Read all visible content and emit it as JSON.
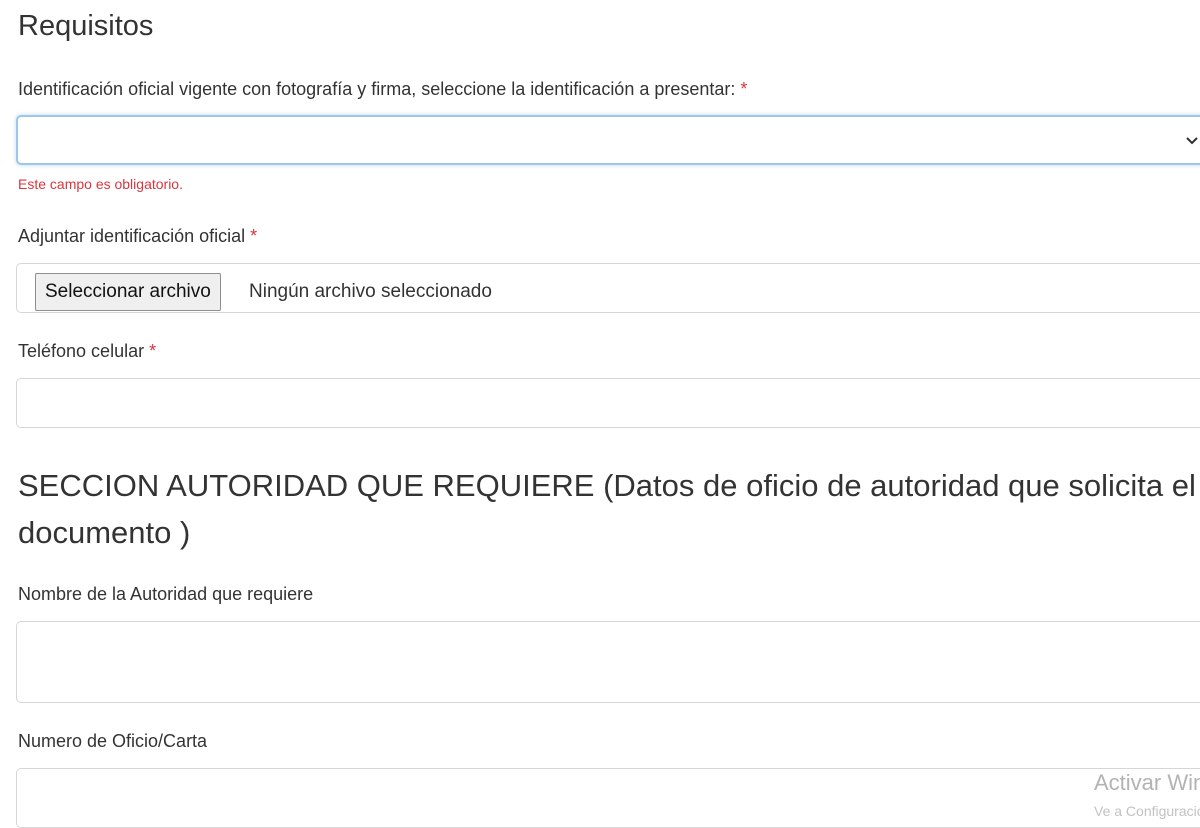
{
  "section_requisitos": {
    "title": "Requisitos"
  },
  "identificacion": {
    "label": "Identificación oficial vigente con fotografía y firma, seleccione la identificación a presentar:",
    "required_mark": "*",
    "selected_value": "",
    "error": "Este campo es obligatorio."
  },
  "adjuntar": {
    "label": "Adjuntar identificación oficial",
    "required_mark": "*",
    "button_label": "Seleccionar archivo",
    "status_text": "Ningún archivo seleccionado"
  },
  "telefono": {
    "label": "Teléfono celular",
    "required_mark": "*",
    "value": ""
  },
  "section_autoridad": {
    "title": "SECCION AUTORIDAD QUE REQUIERE (Datos de oficio de autoridad que solicita el documento )"
  },
  "nombre_autoridad": {
    "label": "Nombre de la Autoridad que requiere",
    "value": ""
  },
  "numero_oficio": {
    "label": "Numero de Oficio/Carta",
    "value": ""
  },
  "watermark": {
    "line1": "Activar Windows",
    "line2": "Ve a Configuración"
  },
  "colors": {
    "text": "#333333",
    "required": "#d9363e",
    "focus_border": "#9cc7ea",
    "input_border": "#d6d6d6",
    "watermark": "#b3b3b3"
  }
}
